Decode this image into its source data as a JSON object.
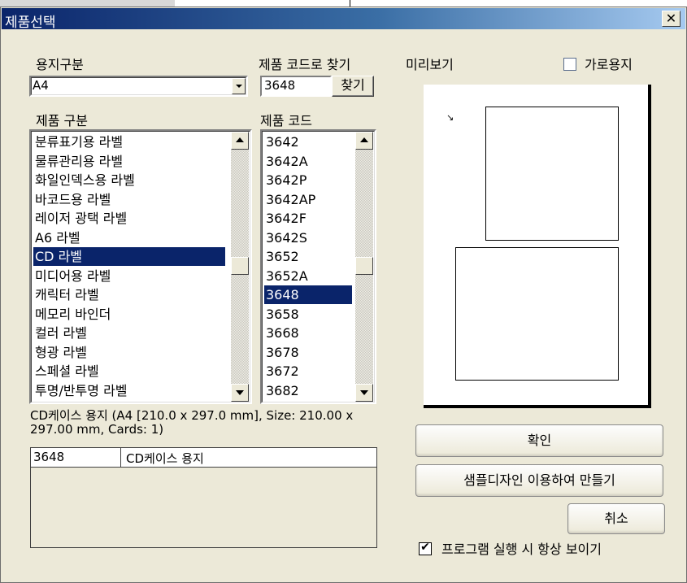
{
  "window": {
    "title": "제품선택",
    "close_glyph": "✕"
  },
  "paper": {
    "label": "용지구분",
    "selected": "A4"
  },
  "code_search": {
    "label": "제품 코드로 찾기",
    "value": "3648",
    "button": "찾기"
  },
  "category": {
    "label": "제품 구분",
    "items": [
      "분류표기용 라벨",
      "물류관리용 라벨",
      "화일인덱스용 라벨",
      "바코드용 라벨",
      "레이저 광택 라벨",
      "A6 라벨",
      "CD 라벨",
      "미디어용 라벨",
      "캐릭터 라벨",
      "메모리 바인더",
      "컬러 라벨",
      "형광 라벨",
      "스페셜 라벨",
      "투명/반투명 라벨"
    ],
    "selected_index": 6
  },
  "codes": {
    "label": "제품 코드",
    "items": [
      "3642",
      "3642A",
      "3642P",
      "3642AP",
      "3642F",
      "3642S",
      "3652",
      "3652A",
      "3648",
      "3658",
      "3668",
      "3678",
      "3672",
      "3682"
    ],
    "selected_index": 8
  },
  "description": "CD케이스 용지 (A4 [210.0 x 297.0 mm], Size: 210.00 x 297.00 mm, Cards: 1)",
  "info_table": {
    "code": "3648",
    "name": "CD케이스 용지"
  },
  "preview": {
    "label": "미리보기",
    "landscape_label": "가로용지",
    "landscape_checked": false,
    "cursor_glyph": "↘"
  },
  "buttons": {
    "ok": "확인",
    "sample_design": "샘플디자인 이용하여 만들기",
    "cancel": "취소"
  },
  "always_show": {
    "label": "프로그램 실행 시 항상 보이기",
    "checked": true,
    "check_glyph": "✔"
  }
}
